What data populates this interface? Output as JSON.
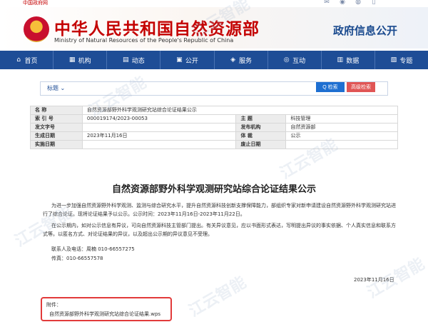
{
  "topbar": {
    "gov_link": "中国政府网",
    "icons": [
      "mail-icon",
      "weibo-icon",
      "wechat-icon",
      "mobile-icon"
    ]
  },
  "header": {
    "title_cn": "中华人民共和国自然资源部",
    "title_en": "Ministry of Natural Resources of the People's Republic of China",
    "section": "政府信息公开"
  },
  "nav": {
    "items": [
      {
        "label": "首页",
        "icon": "home-icon"
      },
      {
        "label": "机构",
        "icon": "org-icon"
      },
      {
        "label": "动态",
        "icon": "news-icon"
      },
      {
        "label": "公开",
        "icon": "open-icon"
      },
      {
        "label": "服务",
        "icon": "service-icon"
      },
      {
        "label": "互动",
        "icon": "interact-icon"
      },
      {
        "label": "数据",
        "icon": "data-icon"
      },
      {
        "label": "专题",
        "icon": "topic-icon"
      }
    ]
  },
  "search": {
    "type": "标题",
    "placeholder": "",
    "search_label": "Q 检索",
    "advanced_label": "高级检索"
  },
  "meta": {
    "name_label": "名 称",
    "name_value": "自然资源部野外科学观测研究站综合论证结果公示",
    "index_label": "索 引 号",
    "index_value": "000019174/2023-00053",
    "subject_label": "主 题",
    "subject_value": "科技管理",
    "doc_label": "发文字号",
    "doc_value": "",
    "issuer_label": "发布机构",
    "issuer_value": "自然资源部",
    "created_label": "生成日期",
    "created_value": "2023年11月16日",
    "category_label": "体 裁",
    "category_value": "公示",
    "effective_label": "实施日期",
    "effective_value": "",
    "repeal_label": "废止日期",
    "repeal_value": ""
  },
  "article": {
    "title": "自然资源部野外科学观测研究站综合论证结果公示",
    "p1": "为进一步加强自然资源野外科学观测、监测与综合研究水平，提升自然资源科技创新支撑保障能力，部组织专家对新申请建设自然资源野外科学观测研究站进行了综合论证。现将论证结果予以公示。公示时间：2023年11月16日-2023年11月22日。",
    "p2": "在公示期内，如对公示信息有异议，可向自然资源科技主管部门提出。有关异议意见，应以书面形式表达，写明提出异议的事实依据、个人真实信息和联系方式等。以匿名方式、对论证结果的异议，以及超出公示期的异议意见不受理。",
    "contact": "联系人及电话：周楠 010-66557275",
    "fax": "传真：010-66557578",
    "date": "2023年11月16日"
  },
  "attachment": {
    "title": "附件：",
    "file": "自然资源部野外科学观测研究站综合论证结果.wps"
  },
  "watermark": "江云智能"
}
